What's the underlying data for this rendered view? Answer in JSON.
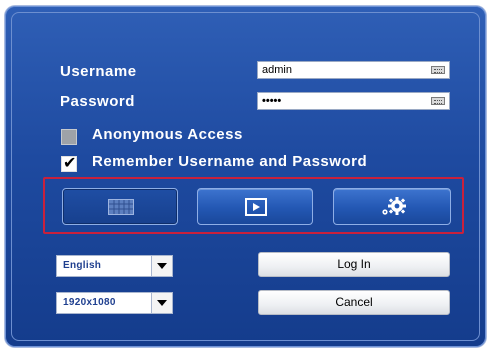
{
  "login": {
    "username_label": "Username",
    "username_value": "admin",
    "password_label": "Password",
    "password_value": "•••••",
    "anonymous_label": "Anonymous Access",
    "anonymous_checked": false,
    "remember_label": "Remember Username and Password",
    "remember_checked": true
  },
  "toolbar": {
    "icons": [
      "multi-screen-icon",
      "playback-icon",
      "settings-gear-icon"
    ],
    "highlight_color": "#c9213c"
  },
  "selects": {
    "language_value": "English",
    "resolution_value": "1920x1080"
  },
  "actions": {
    "login_label": "Log In",
    "cancel_label": "Cancel"
  },
  "colors": {
    "panel": "#1e4aa0",
    "label_text": "#ffffff"
  }
}
